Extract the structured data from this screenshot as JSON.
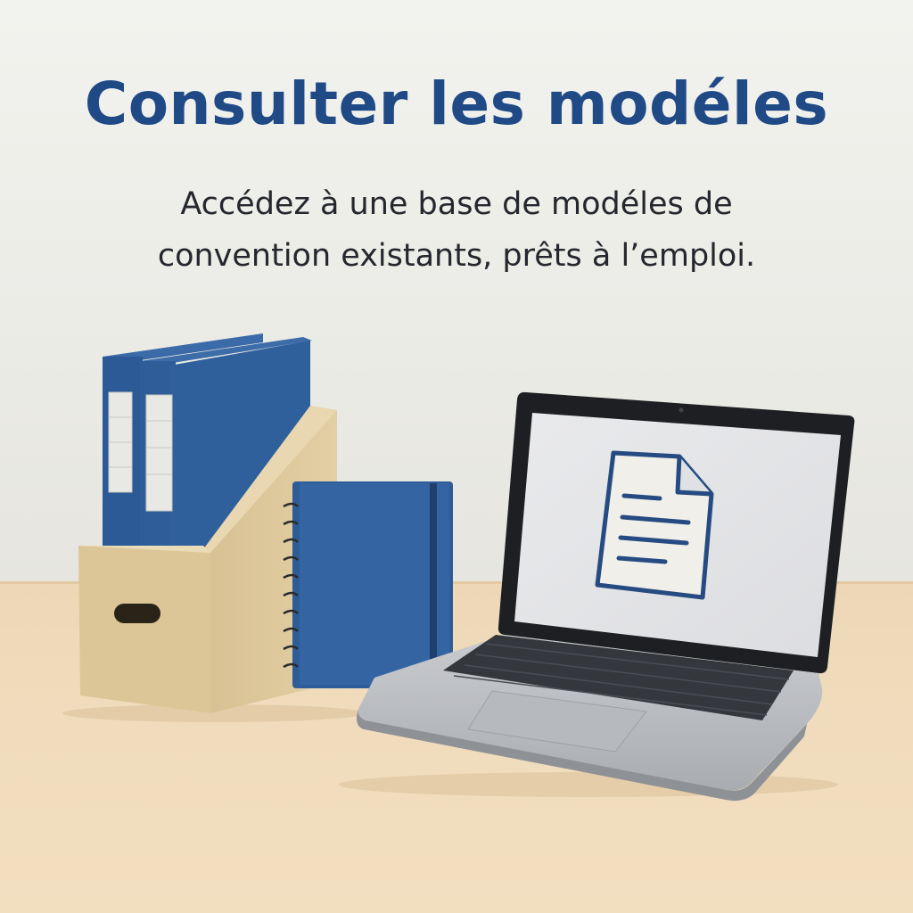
{
  "headline": "Consulter les modéles",
  "subtitle": {
    "line1": "Accédez à une base de modéles de",
    "line2": "convention existants, prêts à l’emploi."
  },
  "illustration": {
    "objects": [
      "binders",
      "magazine-file-box",
      "spiral-notebook",
      "laptop",
      "document-icon"
    ]
  },
  "colors": {
    "headline": "#1f4a86",
    "text": "#24272d",
    "binder_blue": "#2f5d99",
    "box_kraft": "#dcc698",
    "wall": "#ecece7",
    "desk": "#f0dbbb"
  }
}
